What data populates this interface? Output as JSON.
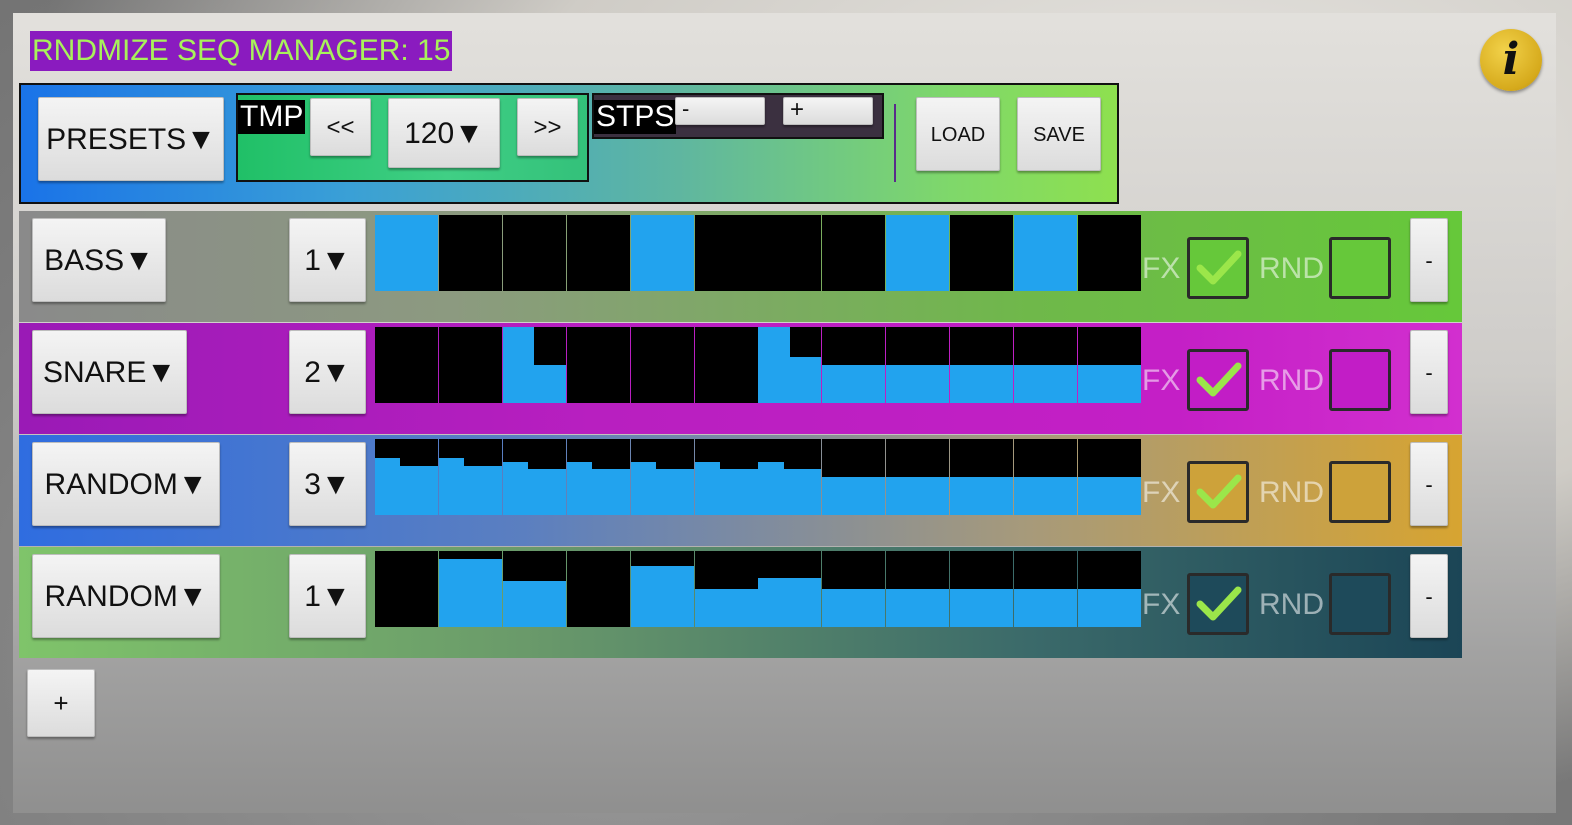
{
  "title": "RNDMIZE SEQ MANAGER: 15",
  "info_icon_glyph": "i",
  "toolbar": {
    "presets_label": "PRESETS▼",
    "tmp_label": "TMP",
    "tempo_prev": "<<",
    "tempo_value": "120▼",
    "tempo_next": ">>",
    "stps_label": "STPS",
    "stps_minus": "-",
    "stps_plus": "+",
    "load_label": "LOAD",
    "save_label": "SAVE"
  },
  "fx_label": "FX",
  "rnd_label": "RND",
  "remove_label": "-",
  "add_label": "+",
  "tracks": [
    {
      "name": "BASS▼",
      "channel": "1▼",
      "color": "#66c83a",
      "fx_checked": true,
      "rnd_checked": false,
      "steps": [
        1,
        0,
        0,
        0,
        1,
        0,
        0,
        0,
        1,
        0,
        1,
        0
      ]
    },
    {
      "name": "SNARE▼",
      "channel": "2▼",
      "color": "#c21dc6",
      "fx_checked": true,
      "rnd_checked": false,
      "steps": [
        0,
        0,
        0.5,
        0,
        0,
        0,
        0.6,
        0.5,
        0.5,
        0.5,
        0.5,
        0.5
      ]
    },
    {
      "name": "RANDOM▼",
      "channel": "3▼",
      "color": "#cda23a",
      "fx_checked": true,
      "rnd_checked": false,
      "steps": [
        0.75,
        0.75,
        0.7,
        0.7,
        0.7,
        0.7,
        0.7,
        0.5,
        0.5,
        0.5,
        0.5,
        0.5
      ]
    },
    {
      "name": "RANDOM▼",
      "channel": "1▼",
      "color": "#1e4a5a",
      "fx_checked": true,
      "rnd_checked": false,
      "steps": [
        0,
        0.9,
        0.6,
        0,
        0.8,
        0.5,
        0.64,
        0.5,
        0.5,
        0.5,
        0.5,
        0.5
      ]
    }
  ]
}
